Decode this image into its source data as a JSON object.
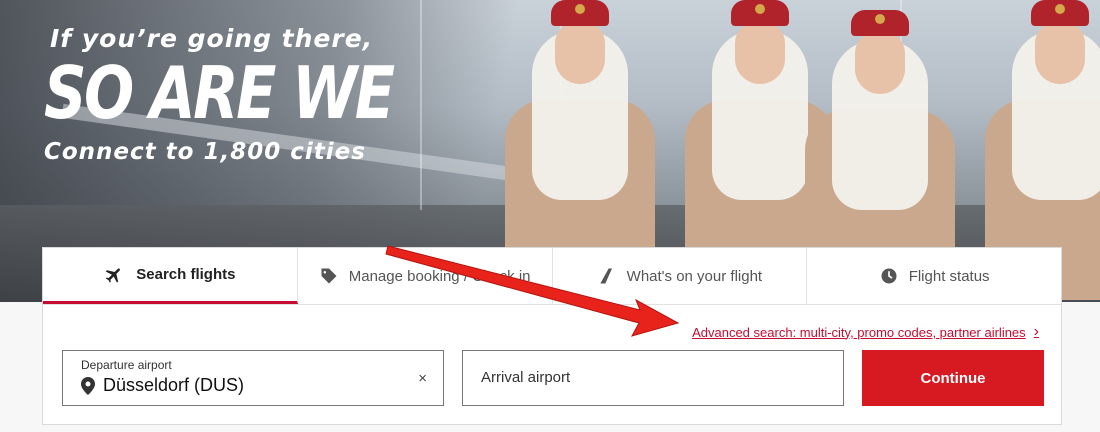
{
  "hero": {
    "line1": "If you’re going there,",
    "line2": "SO ARE WE",
    "line3": "Connect to 1,800 cities"
  },
  "tabs": [
    {
      "label": "Search flights",
      "icon": "airplane-icon",
      "active": true
    },
    {
      "label": "Manage booking / Check in",
      "icon": "tag-icon",
      "active": false
    },
    {
      "label": "What's on your flight",
      "icon": "seat-icon",
      "active": false
    },
    {
      "label": "Flight status",
      "icon": "clock-icon",
      "active": false
    }
  ],
  "advanced_search": {
    "label": "Advanced search: multi-city, promo codes, partner airlines",
    "chevron": "›"
  },
  "departure": {
    "label": "Departure airport",
    "value": "Düsseldorf (DUS)",
    "clear": "×"
  },
  "arrival": {
    "placeholder": "Arrival airport"
  },
  "continue_label": "Continue",
  "colors": {
    "brand_red": "#d71921",
    "link_red": "#c60c30"
  }
}
